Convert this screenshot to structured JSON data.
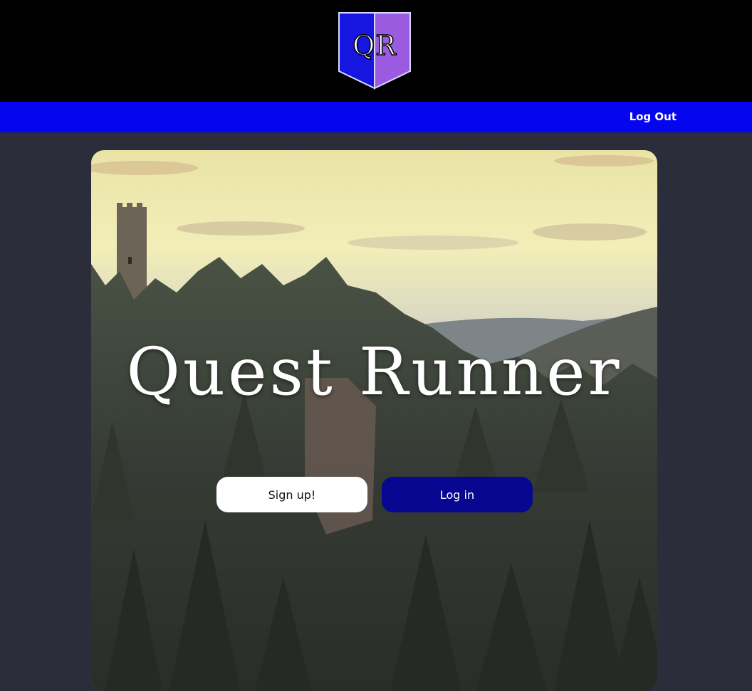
{
  "header": {
    "logo_text": "QR",
    "logo_colors": {
      "left": "#1616e0",
      "right": "#9a5be0"
    }
  },
  "navbar": {
    "color": "#0505f0",
    "logout_label": "Log Out"
  },
  "hero": {
    "title": "Quest Runner",
    "signup_label": "Sign up!",
    "login_label": "Log in",
    "background_image": "castle-tower-forest-landscape"
  },
  "colors": {
    "page_bg": "#2c2d3b",
    "header_bg": "#000000",
    "login_button": "#070791",
    "signup_button": "#ffffff"
  }
}
